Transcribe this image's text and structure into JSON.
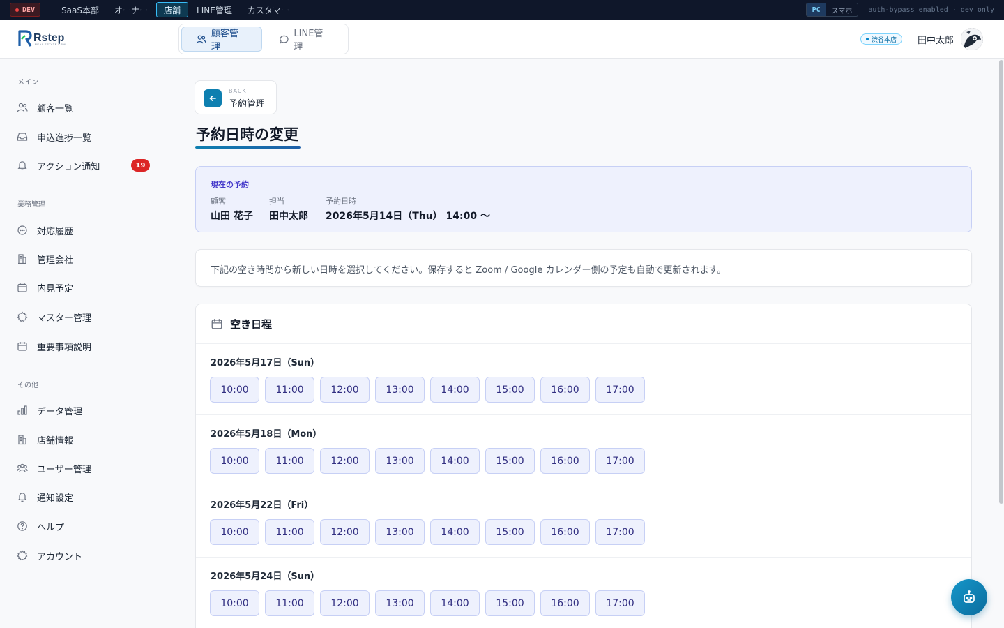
{
  "devbar": {
    "env_badge": "DEV",
    "tabs": [
      "SaaS本部",
      "オーナー",
      "店舗",
      "LINE管理",
      "カスタマー"
    ],
    "active_tab": "店舗",
    "view_toggle": [
      "PC",
      "スマホ"
    ],
    "view_active": "PC",
    "bypass_text": "auth-bypass enabled · dev only"
  },
  "header": {
    "logo_text": "Rstep",
    "logo_sub": "REAL ESTATE CRM",
    "mode_tabs": [
      "顧客管理",
      "LINE管理"
    ],
    "store_badge": "渋谷本店",
    "user_name": "田中太郎"
  },
  "sidebar": {
    "sections": [
      {
        "label": "メイン",
        "items": [
          {
            "label": "顧客一覧",
            "icon": "users-icon"
          },
          {
            "label": "申込進捗一覧",
            "icon": "inbox-icon"
          },
          {
            "label": "アクション通知",
            "icon": "bell-icon",
            "badge": "19"
          }
        ]
      },
      {
        "label": "業務管理",
        "items": [
          {
            "label": "対応履歴",
            "icon": "chat-icon"
          },
          {
            "label": "管理会社",
            "icon": "building-icon"
          },
          {
            "label": "内見予定",
            "icon": "calendar-icon"
          },
          {
            "label": "マスター管理",
            "icon": "gear-icon"
          },
          {
            "label": "重要事項説明",
            "icon": "calendar-icon"
          }
        ]
      },
      {
        "label": "その他",
        "items": [
          {
            "label": "データ管理",
            "icon": "bar-chart-icon"
          },
          {
            "label": "店舗情報",
            "icon": "building-icon"
          },
          {
            "label": "ユーザー管理",
            "icon": "users-gear-icon"
          },
          {
            "label": "通知設定",
            "icon": "bell-icon"
          },
          {
            "label": "ヘルプ",
            "icon": "help-icon"
          },
          {
            "label": "アカウント",
            "icon": "gear-icon"
          }
        ]
      }
    ]
  },
  "main": {
    "back_small": "BACK",
    "back_label": "予約管理",
    "title": "予約日時の変更",
    "current": {
      "label": "現在の予約",
      "customer_key": "顧客",
      "customer": "山田 花子",
      "staff_key": "担当",
      "staff": "田中太郎",
      "datetime_key": "予約日時",
      "datetime": "2026年5月14日（Thu） 14:00 〜"
    },
    "info": "下記の空き時間から新しい日時を選択してください。保存すると Zoom / Google カレンダー側の予定も自動で更新されます。",
    "slots_title": "空き日程",
    "days": [
      {
        "date": "2026年5月17日（Sun）",
        "times": [
          "10:00",
          "11:00",
          "12:00",
          "13:00",
          "14:00",
          "15:00",
          "16:00",
          "17:00"
        ]
      },
      {
        "date": "2026年5月18日（Mon）",
        "times": [
          "10:00",
          "11:00",
          "12:00",
          "13:00",
          "14:00",
          "15:00",
          "16:00",
          "17:00"
        ]
      },
      {
        "date": "2026年5月22日（Fri）",
        "times": [
          "10:00",
          "11:00",
          "12:00",
          "13:00",
          "14:00",
          "15:00",
          "16:00",
          "17:00"
        ]
      },
      {
        "date": "2026年5月24日（Sun）",
        "times": [
          "10:00",
          "11:00",
          "12:00",
          "13:00",
          "14:00",
          "15:00",
          "16:00",
          "17:00"
        ]
      }
    ]
  }
}
